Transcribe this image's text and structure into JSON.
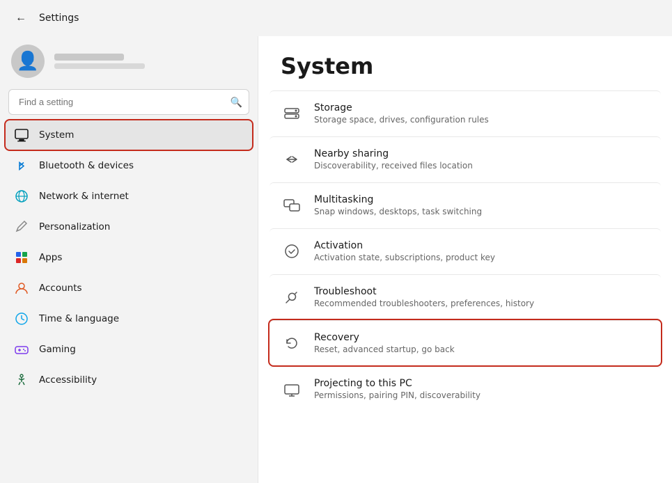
{
  "titlebar": {
    "title": "Settings"
  },
  "sidebar": {
    "search_placeholder": "Find a setting",
    "nav_items": [
      {
        "id": "system",
        "label": "System",
        "icon": "🖥️",
        "active": true
      },
      {
        "id": "bluetooth",
        "label": "Bluetooth & devices",
        "icon": "🔵",
        "active": false
      },
      {
        "id": "network",
        "label": "Network & internet",
        "icon": "🌐",
        "active": false
      },
      {
        "id": "personalization",
        "label": "Personalization",
        "icon": "✏️",
        "active": false
      },
      {
        "id": "apps",
        "label": "Apps",
        "icon": "🟦",
        "active": false
      },
      {
        "id": "accounts",
        "label": "Accounts",
        "icon": "👤",
        "active": false
      },
      {
        "id": "time",
        "label": "Time & language",
        "icon": "🌍",
        "active": false
      },
      {
        "id": "gaming",
        "label": "Gaming",
        "icon": "🎮",
        "active": false
      },
      {
        "id": "accessibility",
        "label": "Accessibility",
        "icon": "♿",
        "active": false
      }
    ]
  },
  "content": {
    "title": "System",
    "items": [
      {
        "id": "storage",
        "icon": "💾",
        "title": "Storage",
        "desc": "Storage space, drives, configuration rules",
        "highlighted": false
      },
      {
        "id": "nearby-sharing",
        "icon": "⇌",
        "title": "Nearby sharing",
        "desc": "Discoverability, received files location",
        "highlighted": false
      },
      {
        "id": "multitasking",
        "icon": "⧉",
        "title": "Multitasking",
        "desc": "Snap windows, desktops, task switching",
        "highlighted": false
      },
      {
        "id": "activation",
        "icon": "✓",
        "title": "Activation",
        "desc": "Activation state, subscriptions, product key",
        "highlighted": false
      },
      {
        "id": "troubleshoot",
        "icon": "🔧",
        "title": "Troubleshoot",
        "desc": "Recommended troubleshooters, preferences, history",
        "highlighted": false
      },
      {
        "id": "recovery",
        "icon": "⏮",
        "title": "Recovery",
        "desc": "Reset, advanced startup, go back",
        "highlighted": true
      },
      {
        "id": "projecting",
        "icon": "📺",
        "title": "Projecting to this PC",
        "desc": "Permissions, pairing PIN, discoverability",
        "highlighted": false
      }
    ]
  }
}
